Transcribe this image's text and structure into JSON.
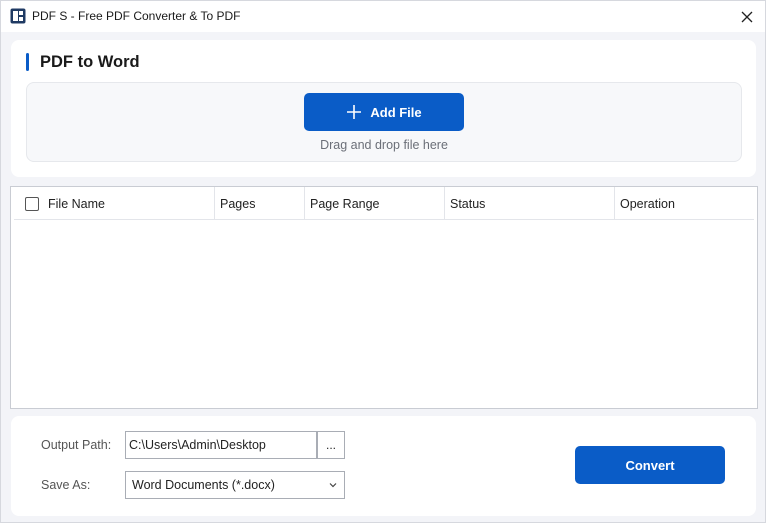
{
  "window": {
    "title": "PDF S - Free PDF Converter & To PDF"
  },
  "section": {
    "title": "PDF to Word"
  },
  "dropzone": {
    "add_file_label": "Add File",
    "hint": "Drag and drop file here"
  },
  "table": {
    "columns": [
      "File Name",
      "Pages",
      "Page Range",
      "Status",
      "Operation"
    ],
    "rows": []
  },
  "output": {
    "path_label": "Output Path:",
    "path_value": "C:\\Users\\Admin\\Desktop",
    "browse_label": "...",
    "save_as_label": "Save As:",
    "save_as_value": "Word Documents (*.docx)"
  },
  "actions": {
    "convert_label": "Convert"
  },
  "colors": {
    "accent": "#0a5cc7",
    "background": "#f3f4f8"
  }
}
